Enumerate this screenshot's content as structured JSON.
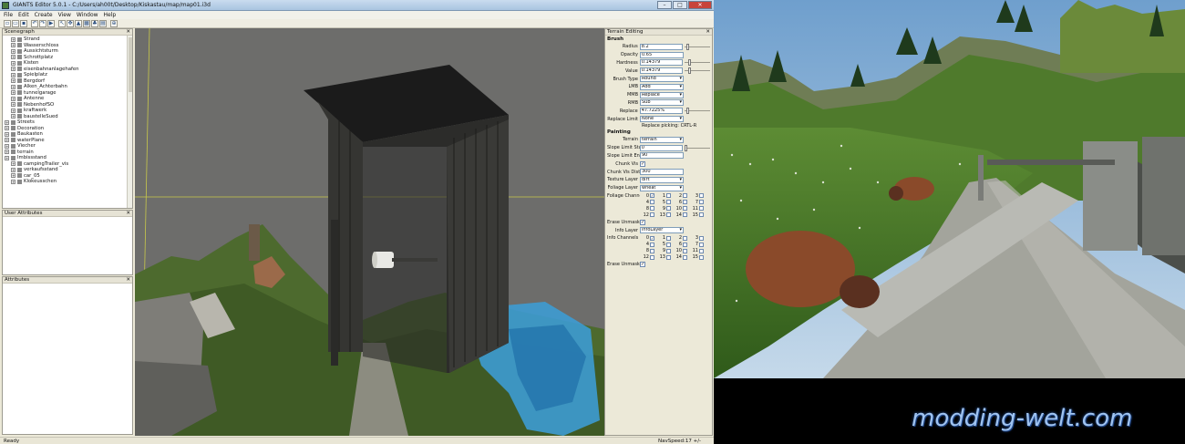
{
  "window": {
    "title": "GIANTS Editor 5.0.1 - C:/Users/ah00t/Desktop/Kiskastau/map/map01.i3d",
    "minimize": "–",
    "maximize": "□",
    "close": "✕"
  },
  "menu": [
    "File",
    "Edit",
    "Create",
    "View",
    "Window",
    "Help"
  ],
  "toolbar": {
    "icons": [
      "new-icon",
      "open-icon",
      "save-icon",
      "undo-icon",
      "redo-icon",
      "play-icon",
      "select-icon",
      "move-icon",
      "terrain-icon",
      "paint-icon",
      "foliage-icon",
      "info-icon",
      "zoom-icon"
    ]
  },
  "scenegraph": {
    "title": "Scenegraph",
    "items": [
      {
        "label": "Strand",
        "indent": 1
      },
      {
        "label": "Wasserschloss",
        "indent": 1
      },
      {
        "label": "Aussichtsturm",
        "indent": 1
      },
      {
        "label": "Schrottplatz",
        "indent": 1
      },
      {
        "label": "Kisten",
        "indent": 1
      },
      {
        "label": "eisenbahnanlagehafen",
        "indent": 1
      },
      {
        "label": "Spielplatz",
        "indent": 1
      },
      {
        "label": "Bergdorf",
        "indent": 1
      },
      {
        "label": "Alken_Achterbahn",
        "indent": 1
      },
      {
        "label": "tunnelgarage",
        "indent": 1
      },
      {
        "label": "Antenne",
        "indent": 1
      },
      {
        "label": "NebenhofSO",
        "indent": 1
      },
      {
        "label": "kraftwerk",
        "indent": 1
      },
      {
        "label": "baustelleSued",
        "indent": 1
      },
      {
        "label": "Streets",
        "indent": 0
      },
      {
        "label": "Decoration",
        "indent": 0
      },
      {
        "label": "Baukasten",
        "indent": 0
      },
      {
        "label": "waterPlane",
        "indent": 0
      },
      {
        "label": "Viecher",
        "indent": 0
      },
      {
        "label": "terrain",
        "indent": 0
      },
      {
        "label": "Imbissstand",
        "indent": 0
      },
      {
        "label": "campingTrailer_vis",
        "indent": 1
      },
      {
        "label": "verkaufsstand",
        "indent": 1
      },
      {
        "label": "car_05",
        "indent": 1
      },
      {
        "label": "Klokeusschen",
        "indent": 1
      }
    ]
  },
  "user_attributes": {
    "title": "User Attributes"
  },
  "attributes": {
    "title": "Attributes"
  },
  "terrain_editing": {
    "title": "Terrain Editing",
    "brush_header": "Brush",
    "radius": {
      "label": "Radius",
      "value": "8.2",
      "level": 0.05
    },
    "opacity": {
      "label": "Opacity",
      "value": "0.65"
    },
    "hardness": {
      "label": "Hardness",
      "value": "0.14379",
      "level": 0.14
    },
    "value": {
      "label": "Value",
      "value": "0.14379",
      "level": 0.14
    },
    "brush_type": {
      "label": "Brush Type",
      "value": "Round"
    },
    "lmb": {
      "label": "LMB",
      "value": "Add"
    },
    "mmb": {
      "label": "MMB",
      "value": "Replace"
    },
    "rmb": {
      "label": "RMB",
      "value": "Sub"
    },
    "replace": {
      "label": "Replace",
      "value": "47.7225%",
      "level": 0.08
    },
    "replace_limit": {
      "label": "Replace Limit",
      "value": "None"
    },
    "replace_hint": "Replace picking: CRTL-R",
    "painting_header": "Painting",
    "terrain": {
      "label": "Terrain",
      "value": "terrain"
    },
    "slope_start": {
      "label": "Slope Limit Start",
      "value": "0",
      "level": 0.0
    },
    "slope_end": {
      "label": "Slope Limit End",
      "value": "90"
    },
    "chunk_vis": {
      "label": "Chunk Vis"
    },
    "chunk_vis_dist": {
      "label": "Chunk Vis Dist",
      "value": "300"
    },
    "texture_layer": {
      "label": "Texture Layer",
      "value": "dirt"
    },
    "foliage_layer": {
      "label": "Foliage Layer",
      "value": "wheat"
    },
    "foliage_channels": {
      "label": "Foliage Channels"
    },
    "erase_unmasked_1": {
      "label": "Erase Unmasked"
    },
    "info_layer": {
      "label": "Info Layer",
      "value": "infoLayer"
    },
    "info_channels": {
      "label": "Info Channels"
    },
    "erase_unmasked_2": {
      "label": "Erase Unmasked"
    },
    "channels": [
      "0",
      "1",
      "2",
      "3",
      "4",
      "5",
      "6",
      "7",
      "8",
      "9",
      "10",
      "11",
      "12",
      "13",
      "14",
      "15"
    ],
    "check": "✓"
  },
  "status": {
    "left": "Ready",
    "right": "NavSpeed:17 +/-"
  },
  "watermark": "modding-welt.com",
  "colors": {
    "accent": "#2a5aa8",
    "watermark": "#9fc3f0"
  }
}
